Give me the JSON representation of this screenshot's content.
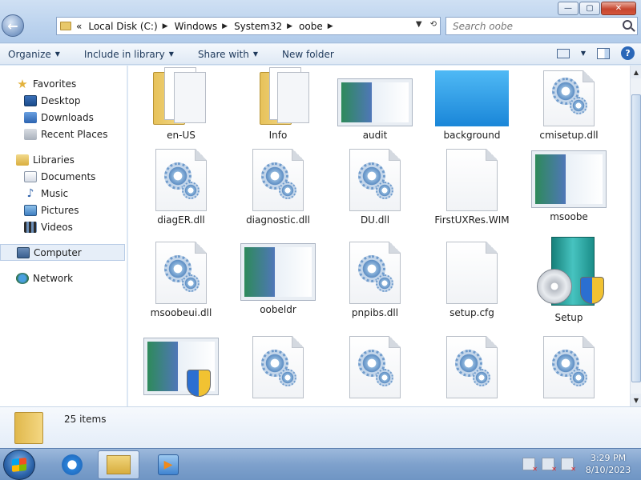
{
  "window": {
    "controls": {
      "minimize": "—",
      "maximize": "▢",
      "close": "✕"
    }
  },
  "address": {
    "overflow": "«",
    "crumbs": [
      "Local Disk (C:)",
      "Windows",
      "System32",
      "oobe"
    ],
    "refresh_glyph": "⟲"
  },
  "search": {
    "placeholder": "Search oobe"
  },
  "toolbar": {
    "organize": "Organize",
    "include_in_library": "Include in library",
    "share_with": "Share with",
    "new_folder": "New folder",
    "help": "?"
  },
  "nav": {
    "favorites": {
      "label": "Favorites",
      "items": [
        "Desktop",
        "Downloads",
        "Recent Places"
      ]
    },
    "libraries": {
      "label": "Libraries",
      "items": [
        "Documents",
        "Music",
        "Pictures",
        "Videos"
      ]
    },
    "computer": "Computer",
    "network": "Network"
  },
  "files": [
    {
      "name": "en-US",
      "type": "folder"
    },
    {
      "name": "Info",
      "type": "folder"
    },
    {
      "name": "audit",
      "type": "image"
    },
    {
      "name": "background",
      "type": "background"
    },
    {
      "name": "cmisetup.dll",
      "type": "dll"
    },
    {
      "name": "diagER.dll",
      "type": "dll"
    },
    {
      "name": "diagnostic.dll",
      "type": "dll"
    },
    {
      "name": "DU.dll",
      "type": "dll"
    },
    {
      "name": "FirstUXRes.WIM",
      "type": "blank"
    },
    {
      "name": "msoobe",
      "type": "image"
    },
    {
      "name": "msoobeui.dll",
      "type": "dll"
    },
    {
      "name": "oobeldr",
      "type": "image"
    },
    {
      "name": "pnpibs.dll",
      "type": "dll"
    },
    {
      "name": "setup.cfg",
      "type": "blank"
    },
    {
      "name": "Setup",
      "type": "setup"
    }
  ],
  "status": {
    "count": "25 items"
  },
  "taskbar": {
    "ie_glyph": "e",
    "media_glyph": "▶",
    "time": "3:29 PM",
    "date": "8/10/2023"
  }
}
